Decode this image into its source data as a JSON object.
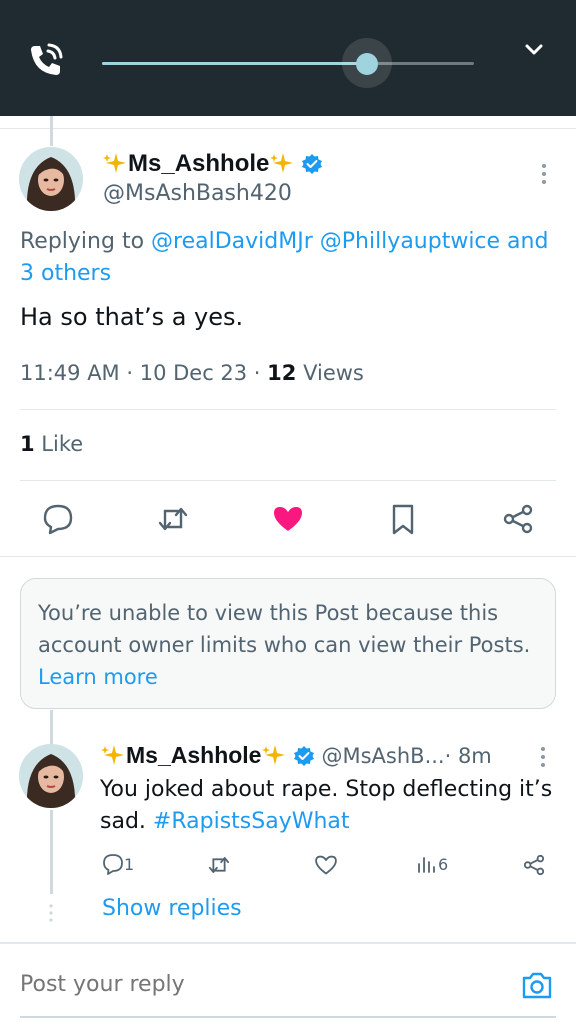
{
  "call_bar": {
    "volume_level": 0.71,
    "accent": "#9fd4df",
    "background": "#1f2b30"
  },
  "main_post": {
    "display_name": "Ms_Ashhole",
    "handle": "@MsAshBash420",
    "reply_prefix": "Replying to ",
    "reply_targets": "@realDavidMJr @Phillyauptwice and 3 others",
    "text": "Ha so that’s a yes.",
    "time_date": "11:49 AM · 10 Dec 23 · ",
    "views_count": "12",
    "views_label": " Views",
    "likes_count": "1",
    "likes_label": " Like"
  },
  "notice": {
    "text": "You’re unable to view this Post because this account owner limits who can view their Posts. ",
    "link": "Learn more"
  },
  "reply_post": {
    "display_name": "Ms_Ashhole",
    "handle": "@MsAshB...",
    "age": " · 8m",
    "text": "You joked about rape. Stop deflecting it’s sad. ",
    "hashtag": "#RapistsSayWhat",
    "reply_count": "1",
    "views_count": "6",
    "show_replies": "Show replies"
  },
  "composer": {
    "placeholder": "Post your reply"
  },
  "colors": {
    "link": "#1d9bf0",
    "like": "#f91880",
    "verified": "#1d9bf0",
    "sparkle": "#f4b400"
  }
}
